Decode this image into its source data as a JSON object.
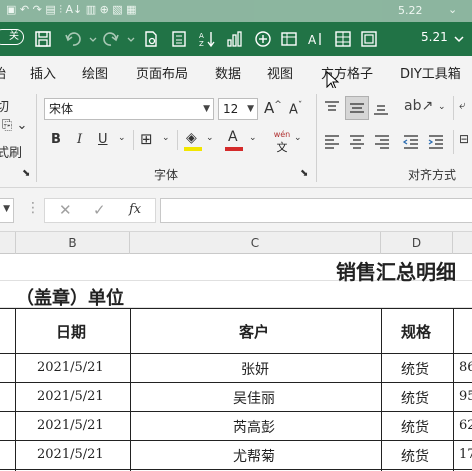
{
  "titlebar": {
    "ghost_version": "5.22",
    "version": "5.21",
    "pill_label": "关"
  },
  "tabs": [
    {
      "label": "插入"
    },
    {
      "label": "绘图"
    },
    {
      "label": "页面布局"
    },
    {
      "label": "数据"
    },
    {
      "label": "视图"
    },
    {
      "label": "方方格子"
    },
    {
      "label": "DIY工具箱"
    }
  ],
  "ribbon": {
    "left_partial": {
      "label1": "切",
      "label2": "式刷"
    },
    "font_name": "宋体",
    "font_size": "12",
    "grow_font": "A",
    "shrink_font": "A",
    "bold": "B",
    "italic": "I",
    "underline": "U",
    "pinyin_top": "wén",
    "pinyin_bottom": "文",
    "font_group_label": "字体",
    "align_group_label": "对齐方式",
    "colors": {
      "highlight": "#f2e600",
      "font_color": "#d42a2a"
    }
  },
  "formula_bar": {
    "fx_label": "fx",
    "content": ""
  },
  "columns": [
    {
      "label": "B"
    },
    {
      "label": "C"
    },
    {
      "label": "D"
    }
  ],
  "sheet": {
    "title": "销售汇总明细",
    "unit_label": "（盖章）单位",
    "headers": {
      "date": "日期",
      "customer": "客户",
      "spec": "规格"
    },
    "rows": [
      {
        "date": "2021/5/21",
        "customer": "张妍",
        "spec": "统货",
        "amount": "86"
      },
      {
        "date": "2021/5/21",
        "customer": "吴佳丽",
        "spec": "统货",
        "amount": "95"
      },
      {
        "date": "2021/5/21",
        "customer": "芮高彭",
        "spec": "统货",
        "amount": "62"
      },
      {
        "date": "2021/5/21",
        "customer": "尤帮菊",
        "spec": "统货",
        "amount": "17"
      }
    ]
  }
}
